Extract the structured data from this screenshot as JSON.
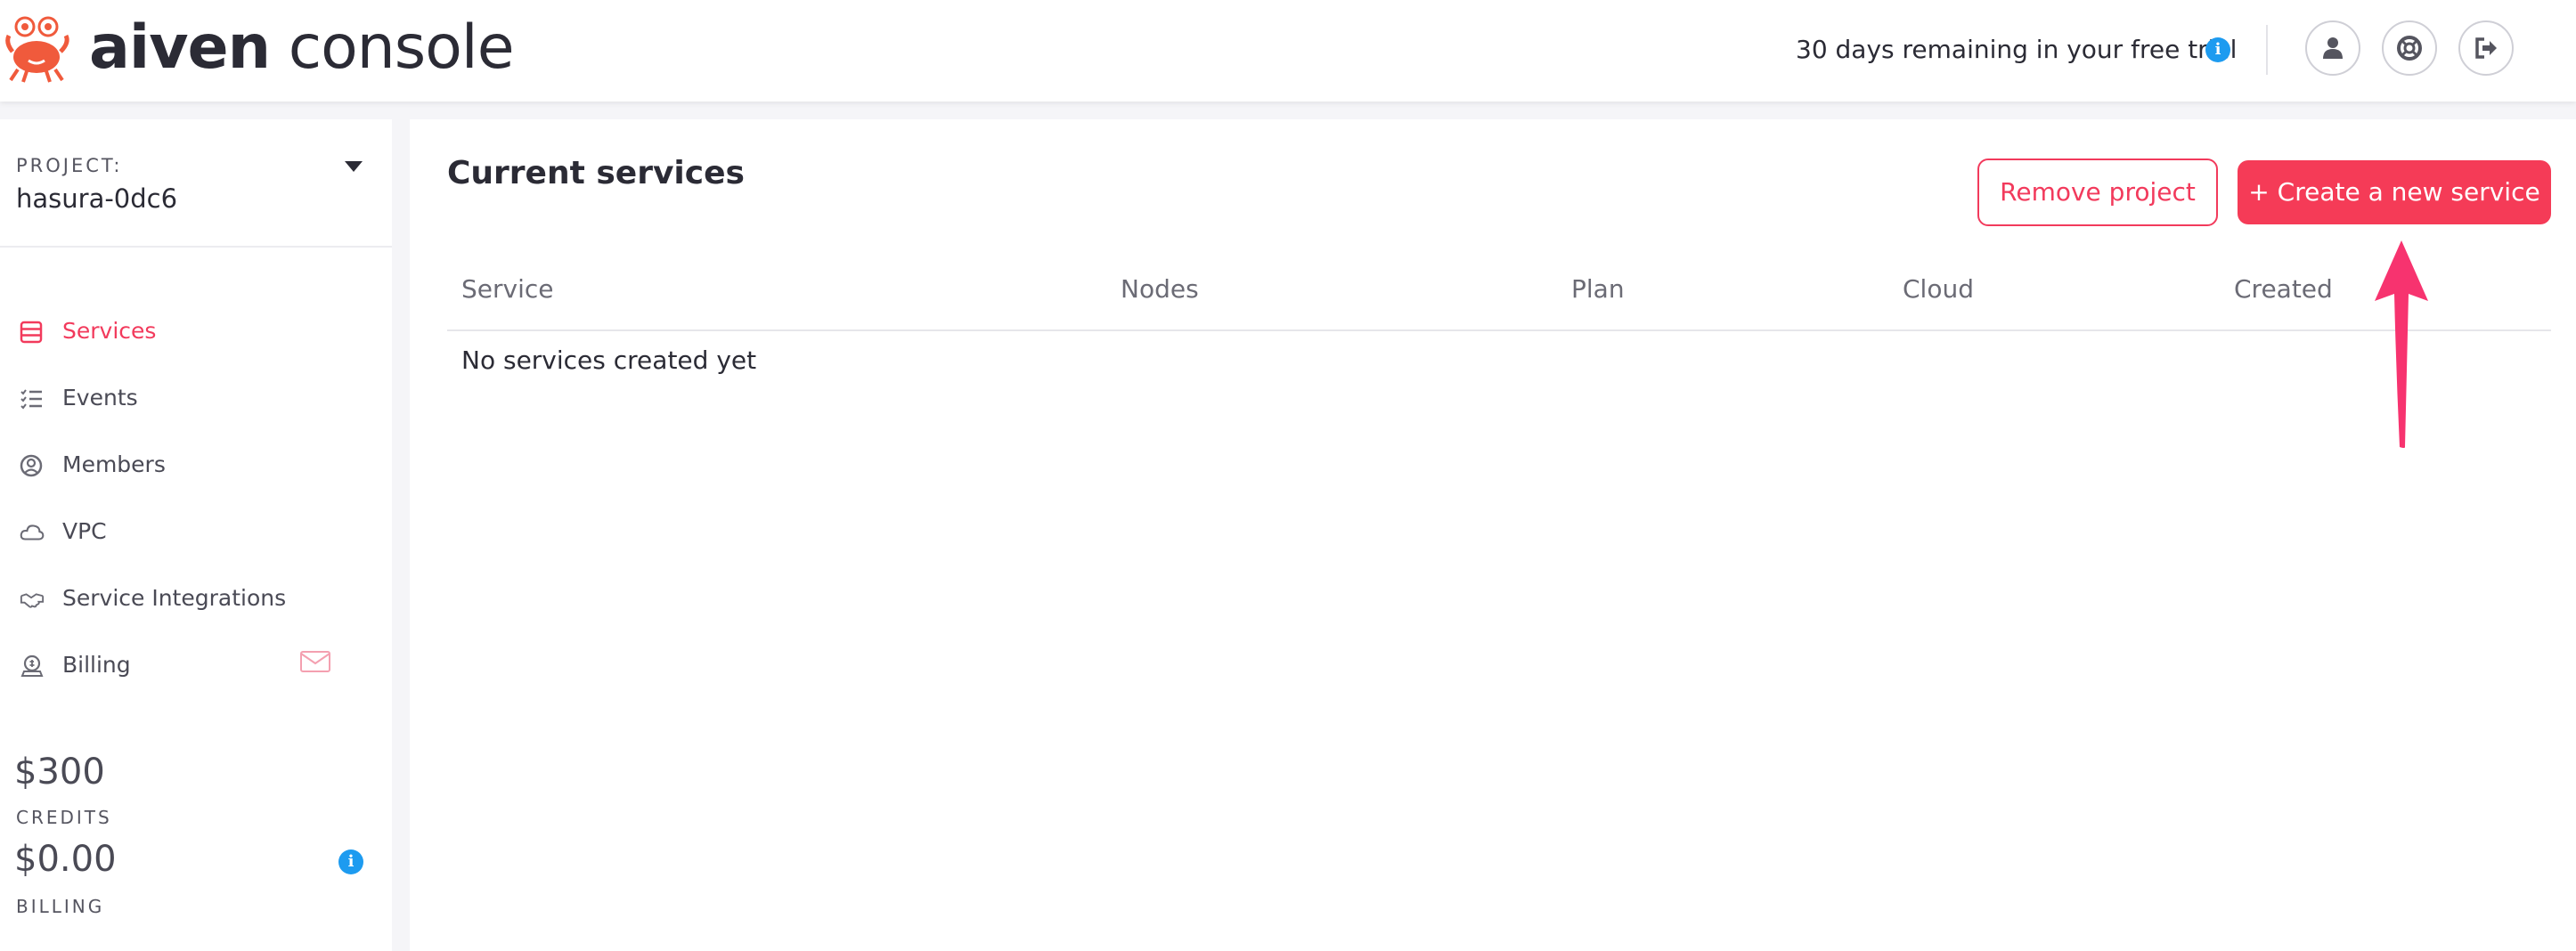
{
  "header": {
    "brand_bold": "aiven",
    "brand_light": "console",
    "trial_text": "30 days remaining in your free trial",
    "info_glyph": "i",
    "buttons": [
      {
        "name": "profile",
        "icon": "user-icon"
      },
      {
        "name": "support",
        "icon": "lifebuoy-icon"
      },
      {
        "name": "logout",
        "icon": "logout-icon"
      }
    ]
  },
  "sidebar": {
    "project_label": "PROJECT:",
    "project_name": "hasura-0dc6",
    "items": [
      {
        "label": "Services",
        "icon": "server-list-icon",
        "active": true
      },
      {
        "label": "Events",
        "icon": "checklist-icon",
        "active": false
      },
      {
        "label": "Members",
        "icon": "user-circle-icon",
        "active": false
      },
      {
        "label": "VPC",
        "icon": "cloud-icon",
        "active": false
      },
      {
        "label": "Service Integrations",
        "icon": "handshake-icon",
        "active": false
      },
      {
        "label": "Billing",
        "icon": "billing-icon",
        "active": false
      }
    ],
    "credits_amount": "$300",
    "credits_label": "CREDITS",
    "billing_amount": "$0.00",
    "billing_label": "BILLING"
  },
  "main": {
    "title": "Current services",
    "remove_button": "Remove project",
    "create_button": "+ Create a new service",
    "columns": [
      "Service",
      "Nodes",
      "Plan",
      "Cloud",
      "Created"
    ],
    "empty_message": "No services created yet"
  },
  "colors": {
    "accent": "#f23a5c",
    "create_button_bg": "#f53b57",
    "annotation_arrow": "#f7336f",
    "info_blue": "#1d9bf0",
    "page_background": "#f5f5f8"
  }
}
